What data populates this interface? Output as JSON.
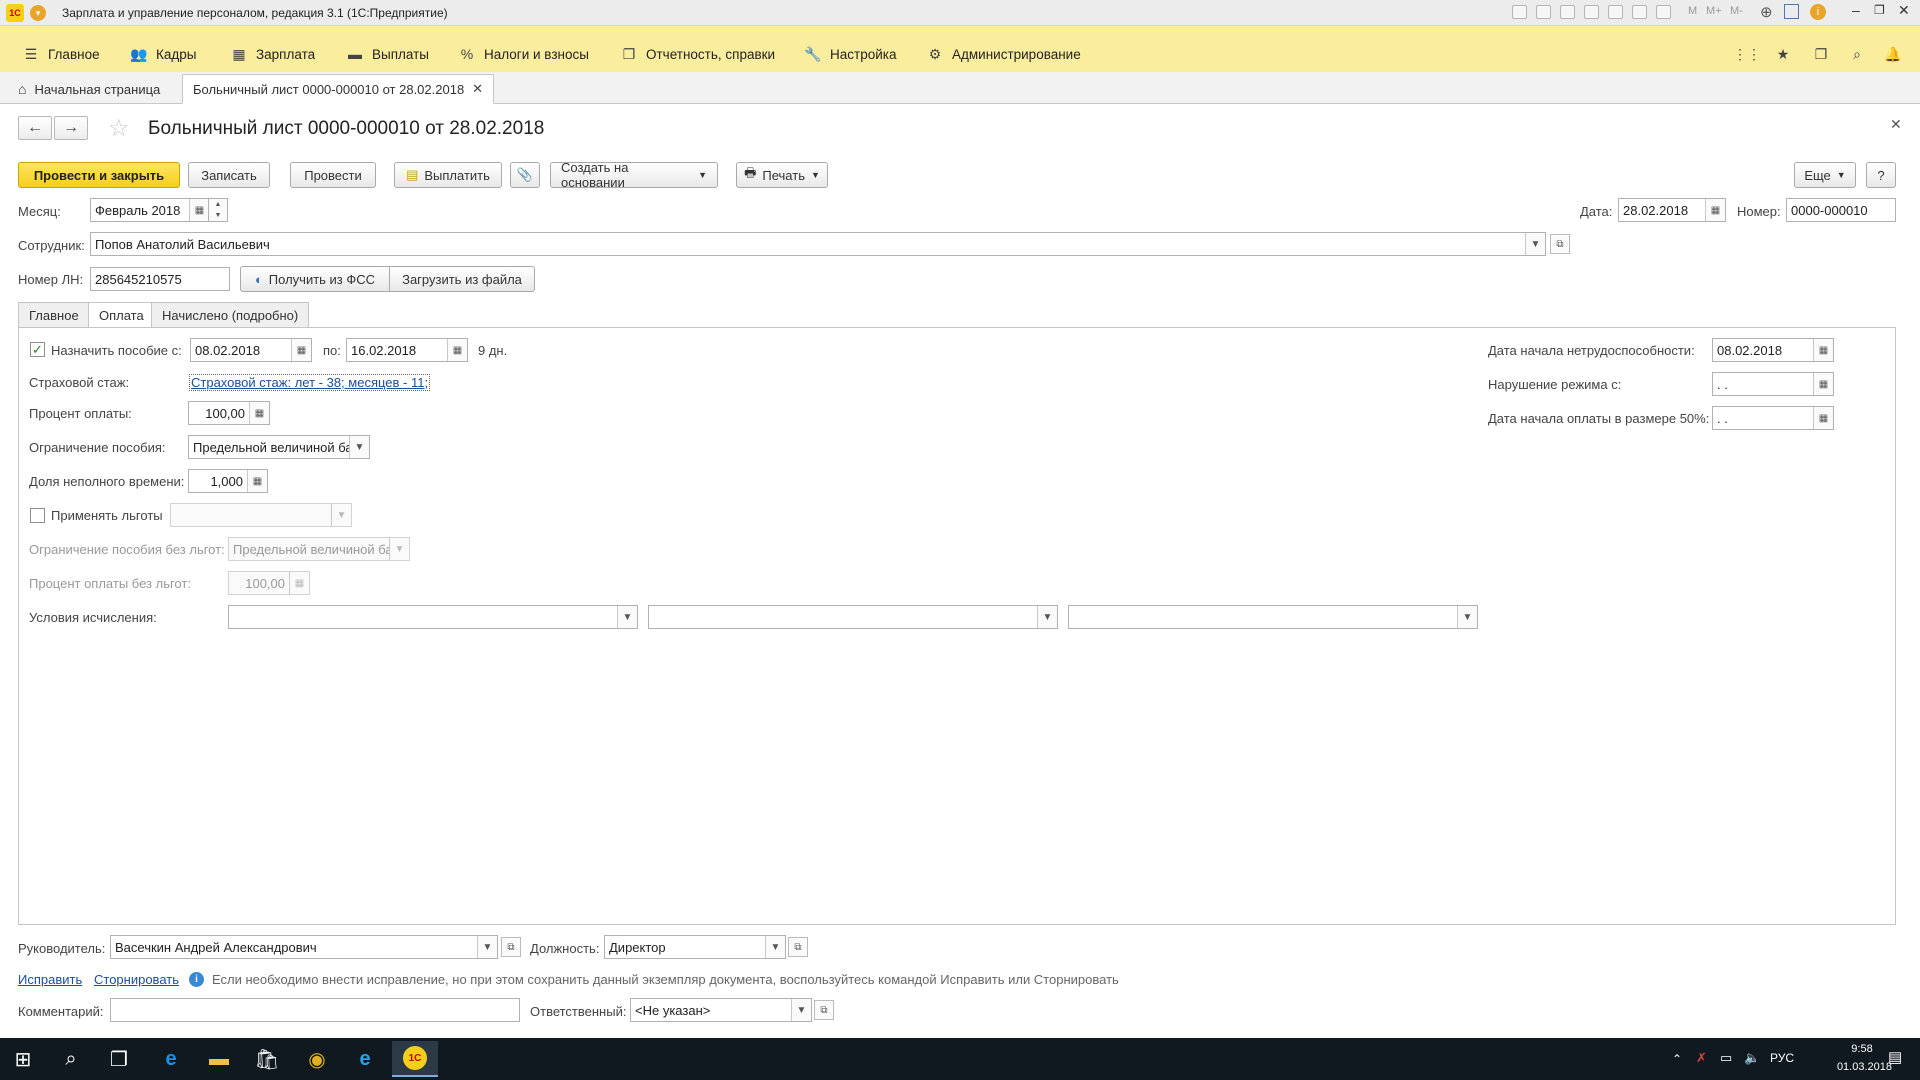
{
  "window": {
    "title": "Зарплата и управление персоналом, редакция 3.1  (1С:Предприятие)"
  },
  "topmenu": {
    "items": [
      "Главное",
      "Кадры",
      "Зарплата",
      "Выплаты",
      "Налоги и взносы",
      "Отчетность, справки",
      "Настройка",
      "Администрирование"
    ]
  },
  "tabs": {
    "home": "Начальная страница",
    "doc": "Больничный лист 0000-000010 от 28.02.2018"
  },
  "doc": {
    "title": "Больничный лист 0000-000010 от 28.02.2018"
  },
  "toolbar": {
    "post_close": "Провести и закрыть",
    "save": "Записать",
    "post": "Провести",
    "pay": "Выплатить",
    "create_based": "Создать на основании",
    "print": "Печать",
    "more": "Еще",
    "help": "?"
  },
  "header": {
    "month_label": "Месяц:",
    "month_value": "Февраль 2018",
    "date_label": "Дата:",
    "date_value": "28.02.2018",
    "number_label": "Номер:",
    "number_value": "0000-000010",
    "employee_label": "Сотрудник:",
    "employee_value": "Попов Анатолий Васильевич",
    "ln_label": "Номер ЛН:",
    "ln_value": "285645210575",
    "get_fss": "Получить из ФСС",
    "load_file": "Загрузить из файла"
  },
  "formtabs": [
    "Главное",
    "Оплата",
    "Начислено (подробно)"
  ],
  "payment": {
    "assign_label": "Назначить пособие с:",
    "assign_from": "08.02.2018",
    "to_label": "по:",
    "assign_to": "16.02.2018",
    "days": "9 дн.",
    "exp_label": "Страховой стаж:",
    "exp_link": "Страховой стаж: лет - 38; месяцев - 11;",
    "percent_label": "Процент оплаты:",
    "percent_value": "100,00",
    "limit_label": "Ограничение пособия:",
    "limit_value": "Предельной величиной базы",
    "parttime_label": "Доля неполного времени:",
    "parttime_value": "1,000",
    "benefits_label": "Применять льготы",
    "limit_nb_label": "Ограничение пособия без льгот:",
    "limit_nb_value": "Предельной величиной базы",
    "percent_nb_label": "Процент оплаты без льгот:",
    "percent_nb_value": "100,00",
    "conditions_label": "Условия исчисления:",
    "disability_start_label": "Дата начала нетрудоспособности:",
    "disability_start_value": "08.02.2018",
    "violation_label": "Нарушение режима с:",
    "violation_value": " .  .",
    "half_pay_label": "Дата начала оплаты в размере 50%:",
    "half_pay_value": " .  ."
  },
  "footer": {
    "manager_label": "Руководитель:",
    "manager_value": "Васечкин Андрей Александрович",
    "position_label": "Должность:",
    "position_value": "Директор",
    "fix_link": "Исправить",
    "storno_link": "Сторнировать",
    "info_text": "Если необходимо внести исправление, но при этом сохранить данный экземпляр документа, воспользуйтесь командой Исправить или Сторнировать",
    "comment_label": "Комментарий:",
    "comment_value": "",
    "responsible_label": "Ответственный:",
    "responsible_value": "<Не указан>"
  },
  "taskbar": {
    "lang": "РУС",
    "time": "9:58",
    "date": "01.03.2018"
  },
  "colors": {
    "menu_bg": "#fbed9e",
    "primary_button": "#f5cf1c",
    "link": "#1a4fa0"
  }
}
